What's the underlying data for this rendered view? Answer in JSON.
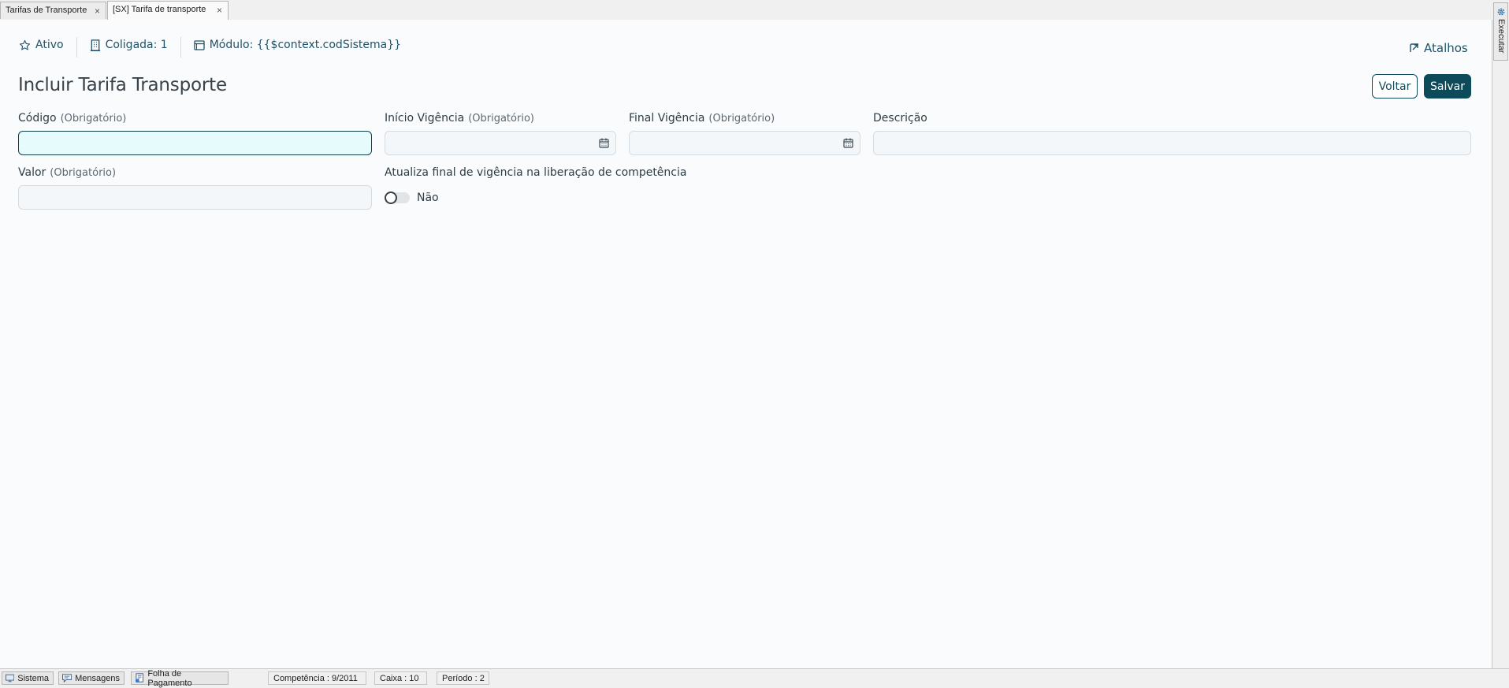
{
  "tabs": [
    {
      "label": "Tarifas de Transporte",
      "close": "×"
    },
    {
      "label": "[SX] Tarifa de transporte",
      "close": "×"
    }
  ],
  "info_bar": {
    "ativo": "Ativo",
    "coligada": "Coligada: 1",
    "modulo": "Módulo: {{$context.codSistema}}",
    "atalhos": "Atalhos"
  },
  "page_title": "Incluir Tarifa Transporte",
  "buttons": {
    "voltar": "Voltar",
    "salvar": "Salvar"
  },
  "form": {
    "codigo": {
      "label": "Código",
      "required": "(Obrigatório)",
      "value": ""
    },
    "inicio_vigencia": {
      "label": "Início Vigência",
      "required": "(Obrigatório)",
      "value": ""
    },
    "final_vigencia": {
      "label": "Final Vigência",
      "required": "(Obrigatório)",
      "value": ""
    },
    "descricao": {
      "label": "Descrição",
      "value": ""
    },
    "valor": {
      "label": "Valor",
      "required": "(Obrigatório)",
      "value": ""
    },
    "atualiza": {
      "label": "Atualiza final de vigência na liberação de competência",
      "state": "Não"
    }
  },
  "side_panel": {
    "executar": "Executar"
  },
  "status_bar": {
    "sistema": "Sistema",
    "mensagens": "Mensagens",
    "folha": "Folha de Pagamento",
    "competencia": "Competência : 9/2011",
    "caixa": "Caixa : 10",
    "periodo": "Período : 2"
  },
  "colors": {
    "primary": "#0d4a5a",
    "focused_field_bg": "#e6fbfc",
    "page_bg": "#f9fbfd"
  },
  "icons": [
    "star-icon",
    "building-icon",
    "window-icon",
    "shortcut-icon",
    "calendar-icon",
    "gear-icon",
    "monitor-icon",
    "message-icon",
    "payroll-icon"
  ]
}
